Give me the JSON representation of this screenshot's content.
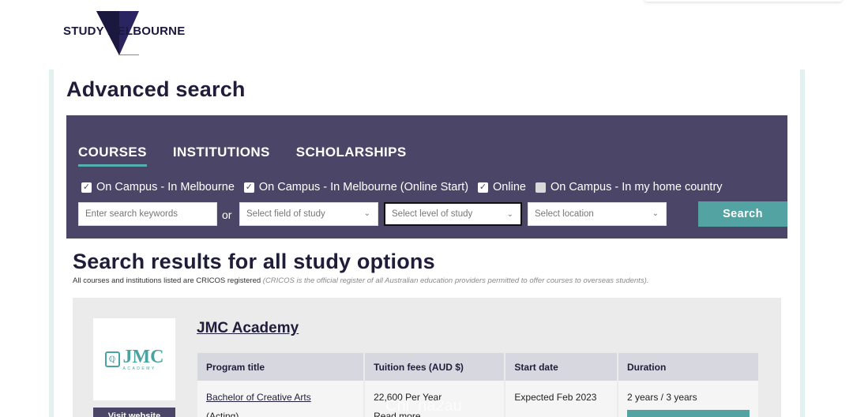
{
  "header": {
    "logo_text": "STUDY MELBOURNE"
  },
  "page": {
    "title": "Advanced search"
  },
  "search_panel": {
    "tabs": [
      {
        "label": "COURSES",
        "active": true
      },
      {
        "label": "INSTITUTIONS",
        "active": false
      },
      {
        "label": "SCHOLARSHIPS",
        "active": false
      }
    ],
    "options": [
      {
        "label": "On Campus - In Melbourne",
        "checked": true
      },
      {
        "label": "On Campus - In Melbourne (Online Start)",
        "checked": true
      },
      {
        "label": "Online",
        "checked": true
      },
      {
        "label": "On Campus - In my home country",
        "checked": false
      }
    ],
    "keywords_placeholder": "Enter search keywords",
    "or_label": "or",
    "field_of_study": "Select field of study",
    "level_of_study": "Select level of study",
    "location": "Select location",
    "search_label": "Search",
    "accent_color": "#54a3a3",
    "panel_color": "#4b4668"
  },
  "results": {
    "title": "Search results for all study options",
    "note": "All courses and institutions listed are CRICOS registered",
    "note_em": "(CRICOS is the official register of all Australian education providers permitted to offer courses to overseas students).",
    "institution": {
      "name": "JMC Academy",
      "logo_big": "JMC",
      "logo_small": "ACADEMY",
      "visit_label": "Visit website",
      "columns": [
        "Program title",
        "Tuition fees (AUD $)",
        "Start date",
        "Duration"
      ],
      "rows": [
        {
          "program": "Bachelor of Creative Arts",
          "program_sub": "(Acting)",
          "fee": "22,600 Per Year",
          "fee_more": "Read more",
          "start": "Expected Feb 2023",
          "duration": "2 years / 3 years"
        }
      ]
    }
  },
  "watermark": "Chi_na2au"
}
